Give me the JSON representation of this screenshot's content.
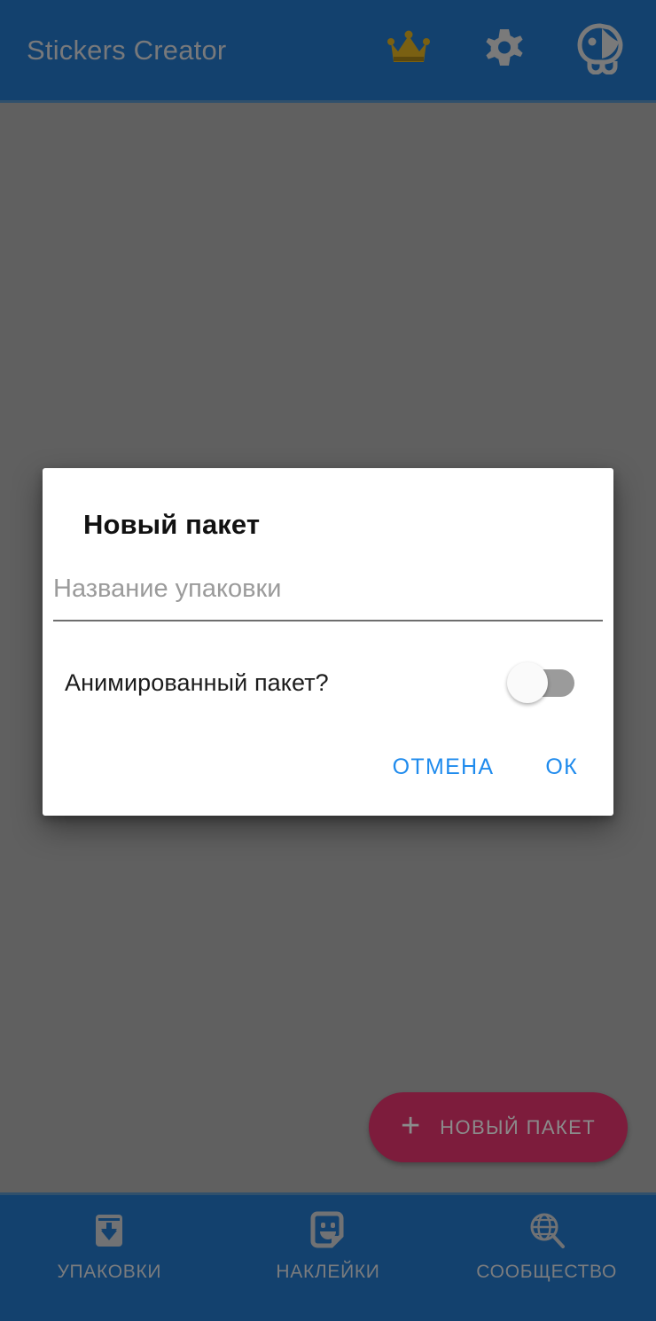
{
  "appbar": {
    "title": "Stickers Creator",
    "actions": [
      {
        "name": "premium-crown-icon",
        "icon": "crown-icon",
        "color": "#7a6012"
      },
      {
        "name": "settings-gear-icon",
        "icon": "gear-icon",
        "color": "#7a7a7a"
      },
      {
        "name": "mascot-bird-icon",
        "icon": "bird-mascot-icon",
        "color": "#7a7a7a"
      }
    ],
    "background": "#13416e",
    "title_color": "#78797b"
  },
  "scrim": {
    "color": "#606060"
  },
  "dialog": {
    "title": "Новый пакет",
    "name_input": {
      "value": "",
      "placeholder": "Название упаковки"
    },
    "animated_label": "Анимированный пакет?",
    "animated_toggle_state": "off",
    "cancel_label": "ОТМЕНА",
    "ok_label": "ОК",
    "action_color": "#1f8bed",
    "background": "#ffffff"
  },
  "fab": {
    "label": "НОВЫЙ ПАКЕТ",
    "plus": "+",
    "background": "#7d1c3c",
    "text_color": "#8b8b8b"
  },
  "bottom_nav": {
    "background": "#13416e",
    "label_color": "#7b7c7e",
    "items": [
      {
        "label": "УПАКОВКИ",
        "icon": "package-download-icon"
      },
      {
        "label": "НАКЛЕЙКИ",
        "icon": "sticker-smiley-icon"
      },
      {
        "label": "СООБЩЕСТВО",
        "icon": "globe-search-icon"
      }
    ]
  }
}
